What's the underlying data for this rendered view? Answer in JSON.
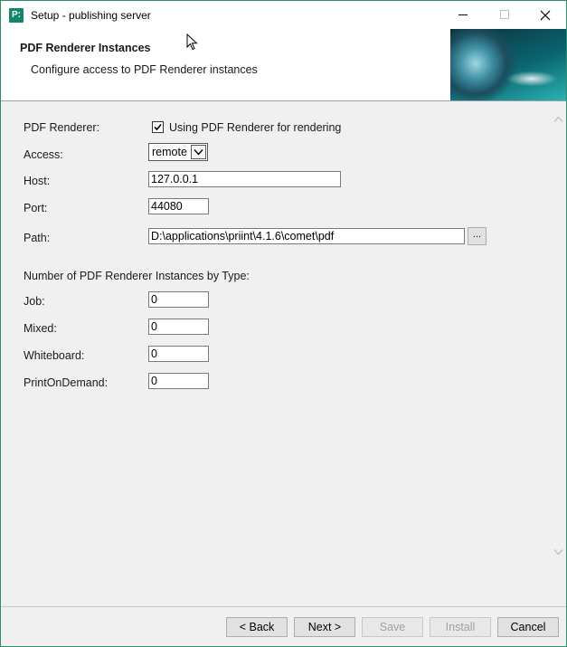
{
  "window": {
    "title": "Setup - publishing server",
    "app_icon_text": "P:",
    "icons": [
      "minimize-icon",
      "maximize-icon",
      "close-icon"
    ]
  },
  "header": {
    "title": "PDF Renderer Instances",
    "subtitle": "Configure access to PDF Renderer instances"
  },
  "form": {
    "renderer_label": "PDF Renderer:",
    "renderer_checkbox_label": "Using PDF Renderer for rendering",
    "renderer_checked": true,
    "access_label": "Access:",
    "access_value": "remote",
    "host_label": "Host:",
    "host_value": "127.0.0.1",
    "port_label": "Port:",
    "port_value": "44080",
    "path_label": "Path:",
    "path_value": "D:\\applications\\priint\\4.1.6\\comet\\pdf",
    "browse_label": "...",
    "instances_heading": "Number of PDF Renderer Instances by Type:",
    "job_label": "Job:",
    "job_value": "0",
    "mixed_label": "Mixed:",
    "mixed_value": "0",
    "whiteboard_label": "Whiteboard:",
    "whiteboard_value": "0",
    "printondemand_label": "PrintOnDemand:",
    "printondemand_value": "0"
  },
  "footer": {
    "back_label": "< Back",
    "next_label": "Next >",
    "save_label": "Save",
    "install_label": "Install",
    "cancel_label": "Cancel"
  },
  "colors": {
    "window_border": "#2a8f6a",
    "app_icon_bg": "#12856a",
    "disabled_text": "#a0a0a0"
  }
}
